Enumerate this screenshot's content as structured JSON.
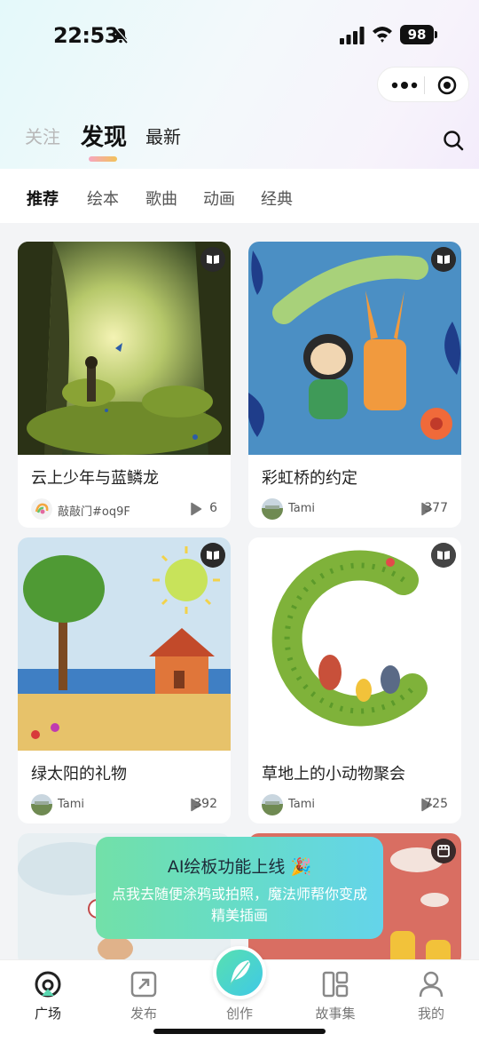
{
  "status_bar": {
    "time": "22:53",
    "battery": "98"
  },
  "top_tabs": [
    {
      "label": "关注"
    },
    {
      "label": "发现"
    },
    {
      "label": "最新"
    }
  ],
  "sub_tabs": [
    {
      "label": "推荐"
    },
    {
      "label": "绘本"
    },
    {
      "label": "歌曲"
    },
    {
      "label": "动画"
    },
    {
      "label": "经典"
    }
  ],
  "cards": [
    {
      "title": "云上少年与蓝鳞龙",
      "author": "敲敲门#oq9F",
      "plays": "6",
      "type_icon": "book-icon"
    },
    {
      "title": "彩虹桥的约定",
      "author": "Tami",
      "plays": "377",
      "type_icon": "book-icon"
    },
    {
      "title": "绿太阳的礼物",
      "author": "Tami",
      "plays": "392",
      "type_icon": "book-icon"
    },
    {
      "title": "草地上的小动物聚会",
      "author": "Tami",
      "plays": "725",
      "type_icon": "book-icon"
    },
    {
      "title": "",
      "author": "",
      "plays": "",
      "type_icon": "book-icon"
    },
    {
      "title": "",
      "author": "",
      "plays": "",
      "type_icon": "video-icon"
    }
  ],
  "toast": {
    "title": "AI绘板功能上线",
    "emoji": "🎉",
    "body": "点我去随便涂鸦或拍照，魔法师帮你变成精美插画"
  },
  "bottom_nav": [
    {
      "label": "广场",
      "icon": "plaza-icon"
    },
    {
      "label": "发布",
      "icon": "publish-icon"
    },
    {
      "label": "创作",
      "icon": "feather-icon"
    },
    {
      "label": "故事集",
      "icon": "collection-icon"
    },
    {
      "label": "我的",
      "icon": "profile-icon"
    }
  ],
  "colors": {
    "accent_gradient_start": "#72e0a8",
    "accent_gradient_end": "#64d4ea",
    "tab_underline_start": "#f6a6c1",
    "tab_underline_end": "#f2c25a"
  }
}
